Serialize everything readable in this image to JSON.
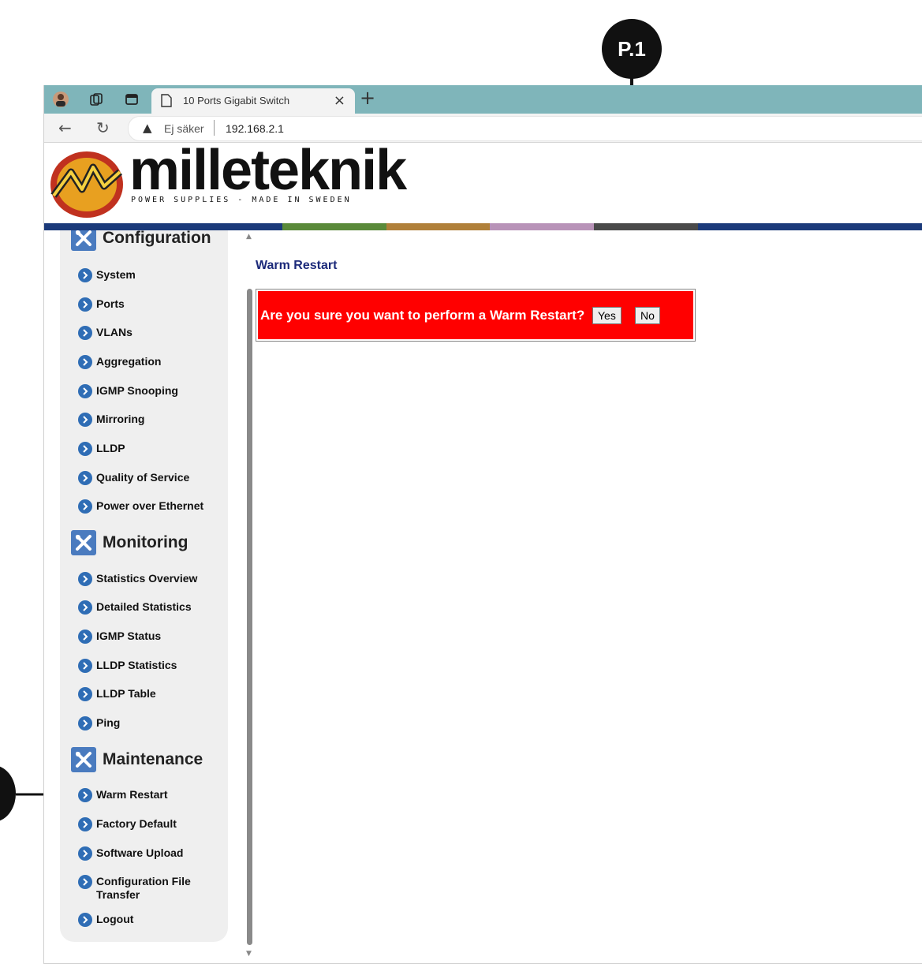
{
  "browser": {
    "tab_title": "10 Ports Gigabit Switch",
    "tab_close": "×",
    "new_tab": "+",
    "security_label": "Ej säker",
    "url": "192.168.2.1"
  },
  "annotations": {
    "top_callout": "P.1"
  },
  "header": {
    "logo_text": "milleteknik",
    "logo_tagline": "POWER SUPPLIES - MADE IN SWEDEN",
    "colorbar": [
      "#1b3a7a",
      "#5a8a3a",
      "#b0803a",
      "#b893b8",
      "#4a4a4a",
      "#1b3a7a"
    ]
  },
  "sidebar": {
    "sections": [
      {
        "label": "Configuration",
        "items": [
          "System",
          "Ports",
          "VLANs",
          "Aggregation",
          "IGMP Snooping",
          "Mirroring",
          "LLDP",
          "Quality of Service",
          "Power over Ethernet"
        ]
      },
      {
        "label": "Monitoring",
        "items": [
          "Statistics Overview",
          "Detailed Statistics",
          "IGMP Status",
          "LLDP Statistics",
          "LLDP Table",
          "Ping"
        ]
      },
      {
        "label": "Maintenance",
        "items": [
          "Warm Restart",
          "Factory Default",
          "Software Upload",
          "Configuration File Transfer",
          "Logout"
        ]
      }
    ]
  },
  "main": {
    "title": "Warm Restart",
    "confirm_text": "Are you sure you want to perform a Warm Restart?",
    "yes_label": "Yes",
    "no_label": "No"
  },
  "colors": {
    "confirm_background": "#ff0000",
    "title_color": "#1c2a7a",
    "tabbar": "#7fb5ba"
  }
}
